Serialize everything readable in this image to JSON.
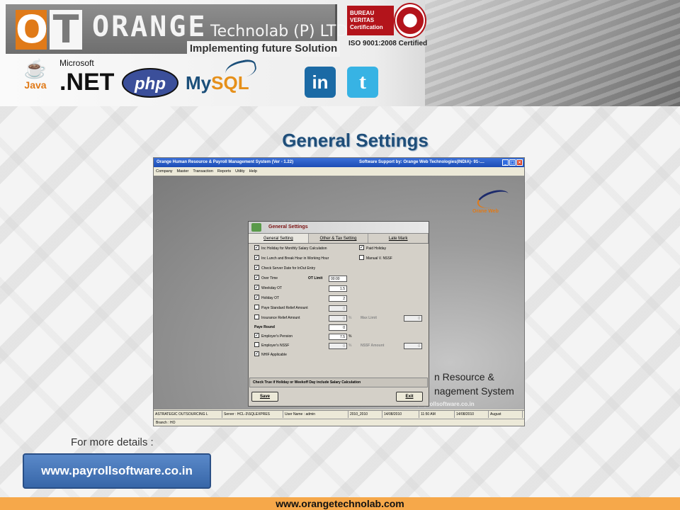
{
  "header": {
    "logo_o": "O",
    "logo_t": "T",
    "company_big": "ORANGE",
    "company_small": "Technolab (P) LTD",
    "tagline": "Implementing future Solution",
    "cert_line1": "BUREAU VERITAS",
    "cert_line2": "Certification",
    "iso": "ISO 9001:2008 Certified",
    "tech_logos": {
      "java": "Java",
      "dotnet_ms": "Microsoft",
      "dotnet": ".NET",
      "php": "php",
      "mysql_a": "My",
      "mysql_b": "SQL"
    },
    "social": {
      "linkedin": "in",
      "twitter": "t"
    }
  },
  "page_title": "General Settings",
  "app": {
    "title": "Orange Human Resource & Payroll Management System (Ver - 1.22)",
    "support": "Software Support by: Orange Web Technologies(INDIA)- 91-....",
    "menu": [
      "Company",
      "Master",
      "Transaction",
      "Reports",
      "Utility",
      "Help"
    ],
    "brand_a": "Oran",
    "brand_b": "e",
    "brand_c": " Web",
    "bg_line1": "n  Resource  &",
    "bg_line2": "nagement  System",
    "bg_url": "www.payrollsoftware.co.in",
    "dialog": {
      "title": "General Settings",
      "tabs": [
        "General Setting",
        "Other & Tax Setting",
        "Late Mark"
      ],
      "checkboxes": {
        "inc_holiday": {
          "label": "Inc Holiday for Monthly Salary Calculation",
          "checked": true
        },
        "paid_holiday": {
          "label": "Paid Holiday",
          "checked": true
        },
        "inc_lunch": {
          "label": "Inc Lunch and Break Hour in Working Hour",
          "checked": true
        },
        "manual_nssf": {
          "label": "Manual V. NSSF",
          "checked": false
        },
        "check_server_date": {
          "label": "Check Server Date for InOut Entry",
          "checked": true
        },
        "over_time": {
          "label": "Over Time",
          "checked": true
        },
        "weekday_ot": {
          "label": "Weekday OT",
          "checked": true
        },
        "holiday_ot": {
          "label": "Holiday OT",
          "checked": true
        },
        "paye_relief": {
          "label": "Paye Standard Relief Amount",
          "checked": false
        },
        "insurance_relief": {
          "label": "Insurance Relief Amount",
          "checked": false
        },
        "employers_pension": {
          "label": "Employer's Pension",
          "checked": true
        },
        "employers_nssf": {
          "label": "Employer's NSSF",
          "checked": false
        },
        "nhif": {
          "label": "NHIF Applicable",
          "checked": true
        }
      },
      "ot_limit_label": "OT Limit",
      "ot_limit": "00:00",
      "weekday_ot": "1.5",
      "holiday_ot": "2",
      "paye_relief": "0",
      "insurance_relief": "0",
      "max_limit_label": "Max Limit",
      "max_limit": "0",
      "paye_round_label": "Paye Round",
      "paye_round": "0",
      "employers_pension": "7.5",
      "employers_nssf": "0",
      "nssf_amount_label": "NSSF Amount",
      "nssf_amount": "0",
      "pct": "%",
      "status": "Check True if Holiday or Weekoff Day include Salary Calculation",
      "save": "Save",
      "exit": "Exit",
      "checkmark": "✓"
    },
    "status_bar": [
      "ASTRATEGIC OUTSOURCING L",
      "Server : HCL-3\\SQLEXPRES",
      "User Name : admin",
      "2010_2010",
      "14/08/2010",
      "11:50 AM",
      "14/08/2010",
      "August"
    ],
    "branch": "Branch : HO"
  },
  "more_details": "For more details :",
  "website_button": "www.payrollsoftware.co.in",
  "footer_url": "www.orangetechnolab.com"
}
